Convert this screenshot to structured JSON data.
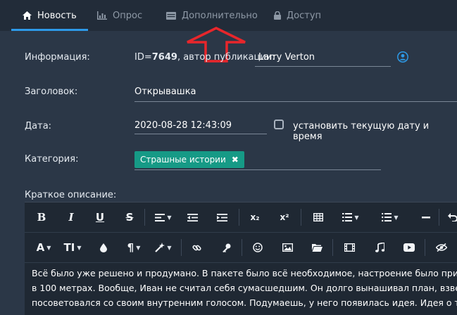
{
  "tabs": [
    {
      "label": "Новость",
      "icon": "home-icon",
      "active": true
    },
    {
      "label": "Опрос",
      "icon": "bar-chart-icon",
      "active": false
    },
    {
      "label": "Дополнительно",
      "icon": "table-icon",
      "active": false
    },
    {
      "label": "Доступ",
      "icon": "lock-icon",
      "active": false
    }
  ],
  "form": {
    "info_label": "Информация:",
    "id_prefix": "ID=",
    "id_value": "7649",
    "author_text": ", автор публикации:",
    "author_value": "Larry Verton",
    "title_label": "Заголовок:",
    "title_value": "Открывашка",
    "date_label": "Дата:",
    "date_value": "2020-08-28 12:43:09",
    "date_now_label": "установить текущую дату и время",
    "category_label": "Категория:",
    "category_tag": "Страшные истории",
    "short_desc_label": "Краткое описание:"
  },
  "editor": {
    "toolbar_row1": [
      "B",
      "I",
      "U",
      "S",
      "align",
      "indent-decrease",
      "indent-increase",
      "x₂",
      "x²",
      "table",
      "ordered-list",
      "unordered-list",
      "horizontal-rule",
      "undo"
    ],
    "toolbar_row2": [
      "A",
      "TI",
      "color",
      "¶",
      "magic",
      "link",
      "key",
      "smile",
      "image",
      "folder",
      "video",
      "music",
      "youtube",
      "hide"
    ],
    "lines": [
      "Всё было уже решено и продумано. В пакете было всё необходимое, настроение было при",
      "в 100 метрах. Вообще, Иван не считал себя сумасшедшим. Он долго вынашивал план, взве",
      "посоветовался со своим внутренним голосом. Подумаешь, у него появилась идея. Идея о т"
    ]
  },
  "colors": {
    "background": "#2b3747",
    "tab_active_underline": "#2d9ae8",
    "tag": "#169a86",
    "annotation_arrow": "#e8262b"
  }
}
